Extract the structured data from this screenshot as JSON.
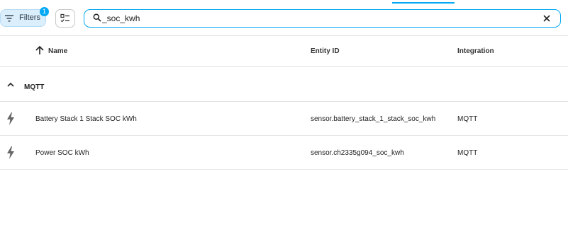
{
  "toolbar": {
    "filters_label": "Filters",
    "filters_badge": "1",
    "search_value": "_soc_kwh"
  },
  "table": {
    "columns": [
      "Name",
      "Entity ID",
      "Integration"
    ],
    "group": "MQTT",
    "rows": [
      {
        "name": "Battery Stack 1 Stack SOC kWh",
        "entity_id": "sensor.battery_stack_1_stack_soc_kwh",
        "integration": "MQTT"
      },
      {
        "name": "Power SOC kWh",
        "entity_id": "sensor.ch2335g094_soc_kwh",
        "integration": "MQTT"
      }
    ]
  },
  "icons": [
    "filter-icon",
    "select-mode-icon",
    "search-icon",
    "close-icon",
    "arrow-up-icon",
    "chevron-up-icon",
    "lightning-bolt-icon"
  ],
  "colors": {
    "accent": "#03a9f4",
    "filter_bg": "#dbeefb",
    "divider": "#e0e0e0"
  }
}
